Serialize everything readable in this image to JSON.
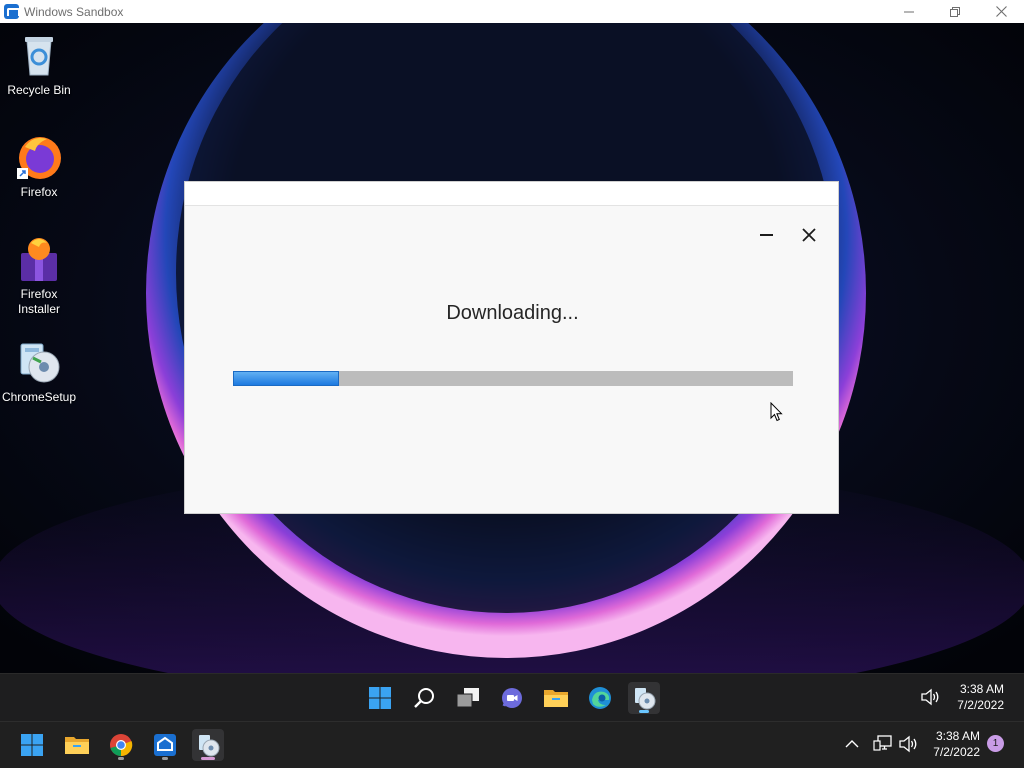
{
  "window": {
    "title": "Windows Sandbox",
    "minimize_icon": "minimize-icon",
    "restore_icon": "restore-icon",
    "close_icon": "close-icon"
  },
  "desktop": {
    "icons": [
      {
        "label": "Recycle Bin",
        "icon": "recycle-bin-icon"
      },
      {
        "label": "Firefox",
        "icon": "firefox-icon"
      },
      {
        "label": "Firefox Installer",
        "icon": "firefox-installer-icon"
      },
      {
        "label": "ChromeSetup",
        "icon": "chrome-setup-icon"
      }
    ]
  },
  "dialog": {
    "status": "Downloading...",
    "progress": 0.19,
    "colors": {
      "progress_fill": "#1d7ae0",
      "track": "#bcbcbc"
    }
  },
  "sandbox_taskbar": {
    "icons": [
      "start-icon",
      "search-icon",
      "task-view-icon",
      "chat-icon",
      "file-explorer-icon",
      "edge-icon",
      "chrome-setup-icon"
    ],
    "active": "chrome-setup-icon",
    "time": "3:38 AM",
    "date": "7/2/2022",
    "volume_icon": "volume-icon"
  },
  "host_taskbar": {
    "icons": [
      "start-icon",
      "file-explorer-icon",
      "chrome-icon",
      "windows-sandbox-icon",
      "chrome-setup-icon"
    ],
    "active": "chrome-setup-icon",
    "time": "3:38 AM",
    "date": "7/2/2022",
    "notification_count": "1"
  }
}
